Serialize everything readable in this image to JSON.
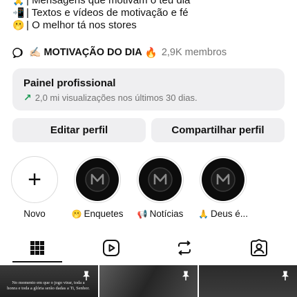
{
  "bio": [
    {
      "emoji": "🙏",
      "text": "| Mensagens que motivam o teu dia"
    },
    {
      "emoji": "📲",
      "text": "| Textos e vídeos de motivação e fé"
    },
    {
      "emoji": "🫢",
      "text": "| O melhor tá nos stores"
    }
  ],
  "channel": {
    "emoji": "✍🏻",
    "title": "MOTIVAÇÃO DO DIA",
    "fire": "🔥",
    "members": "2,9K membros"
  },
  "panel": {
    "title": "Painel profissional",
    "subtitle": "2,0 mi visualizações nos últimos 30 dias."
  },
  "buttons": {
    "edit": "Editar perfil",
    "share": "Compartilhar perfil"
  },
  "highlights": [
    {
      "label": "Novo",
      "emoji": ""
    },
    {
      "label": "Enquetes",
      "emoji": "🫢"
    },
    {
      "label": "Notícias",
      "emoji": "📢"
    },
    {
      "label": "Deus é...",
      "emoji": "🙏"
    }
  ],
  "tabs": [
    "grid-icon",
    "reels-icon",
    "reposts-icon",
    "tagged-icon"
  ],
  "posts": [
    {
      "caption": "No momento em que o jogo virar, toda a honra e toda a glória serão dadas a Ti, Senhor."
    },
    {
      "caption": ""
    },
    {
      "caption": ""
    }
  ],
  "colors": {
    "panel_bg": "#efeff1",
    "growth_arrow": "#1c9a53",
    "muted_text": "#737373",
    "fire": "#e8541c"
  }
}
